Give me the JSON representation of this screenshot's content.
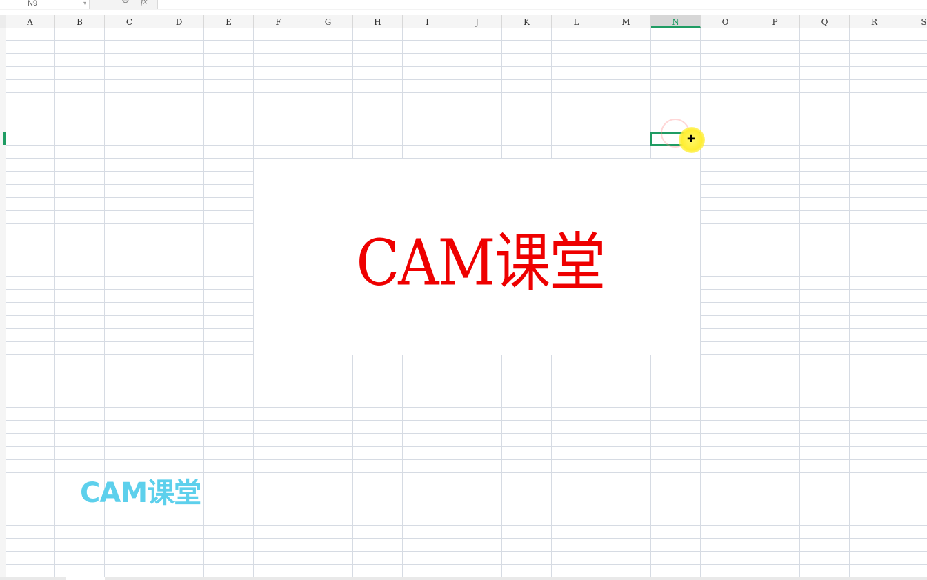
{
  "formula_bar": {
    "name_box": "N9",
    "zoom_icon": "zoom-icon",
    "fx_label": "fx",
    "formula_value": ""
  },
  "columns": [
    "A",
    "B",
    "C",
    "D",
    "E",
    "F",
    "G",
    "H",
    "I",
    "J",
    "K",
    "L",
    "M",
    "N",
    "O",
    "P",
    "Q",
    "R",
    "S"
  ],
  "active_column": "N",
  "image": {
    "text": "CAM课堂",
    "color": "#ee0000"
  },
  "watermark": {
    "text": "CAM课堂",
    "color": "#5dd0ec"
  },
  "accent_color": "#1f9c63"
}
